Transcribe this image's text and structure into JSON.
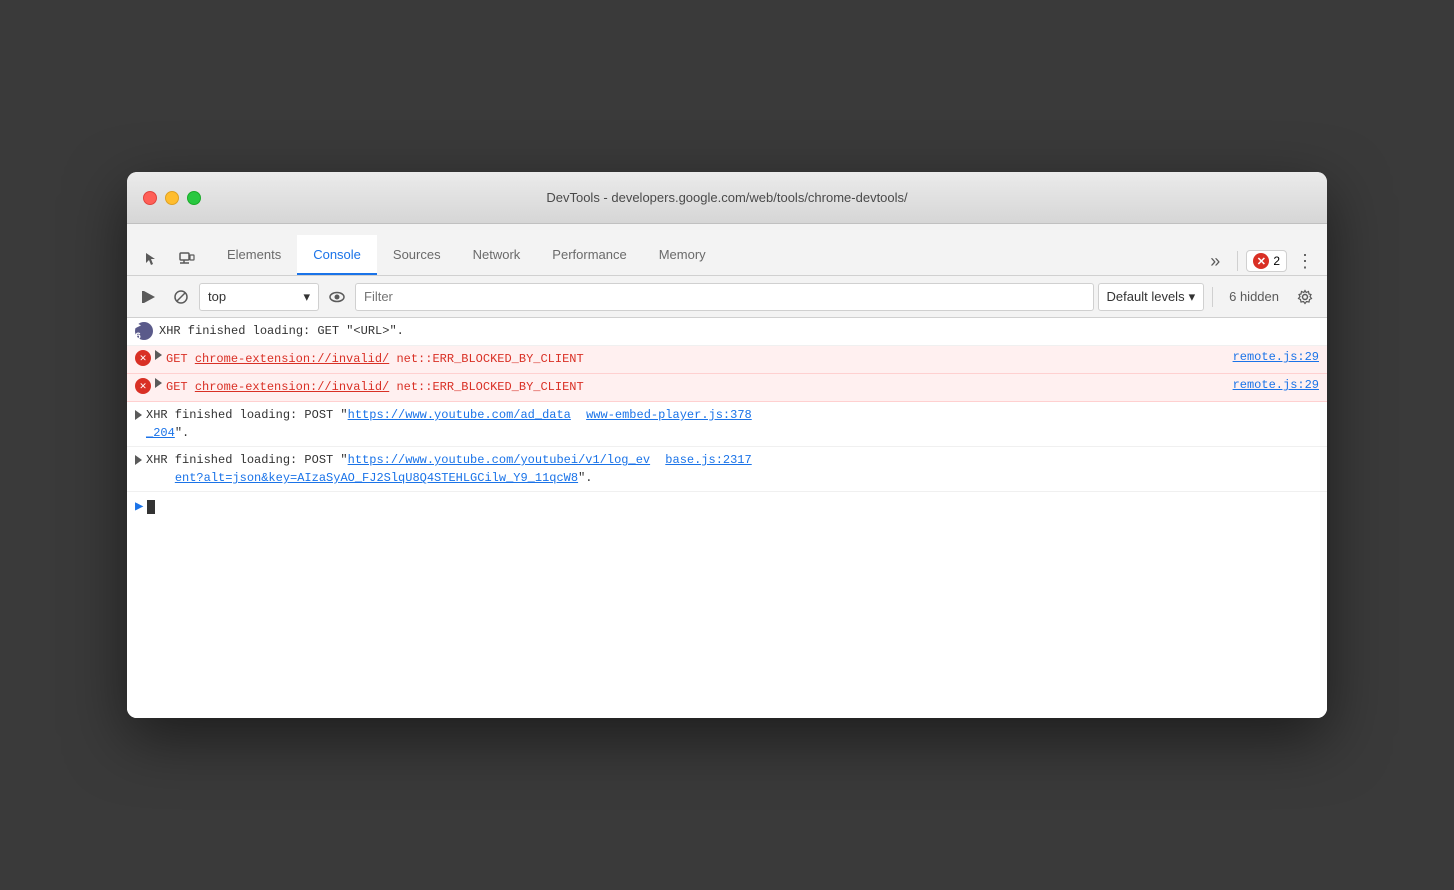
{
  "window": {
    "title": "DevTools - developers.google.com/web/tools/chrome-devtools/"
  },
  "tabs": {
    "items": [
      {
        "id": "elements",
        "label": "Elements",
        "active": false
      },
      {
        "id": "console",
        "label": "Console",
        "active": true
      },
      {
        "id": "sources",
        "label": "Sources",
        "active": false
      },
      {
        "id": "network",
        "label": "Network",
        "active": false
      },
      {
        "id": "performance",
        "label": "Performance",
        "active": false
      },
      {
        "id": "memory",
        "label": "Memory",
        "active": false
      }
    ],
    "more_label": "»",
    "error_count": "2",
    "more_options": "⋮"
  },
  "toolbar": {
    "context_value": "top",
    "context_arrow": "▾",
    "filter_placeholder": "Filter",
    "levels_label": "Default levels",
    "levels_arrow": "▾",
    "hidden_count": "6 hidden"
  },
  "console_entries": [
    {
      "id": "xhr1",
      "type": "xhr",
      "badge": "▶ 6",
      "text": "XHR finished loading: GET \"<URL>\".",
      "source": null,
      "error": false
    },
    {
      "id": "err1",
      "type": "error",
      "text": "GET",
      "url": "chrome-extension://invalid/",
      "error_text": "net::ERR_BLOCKED_BY_CLIENT",
      "source": "remote.js:29",
      "error": true
    },
    {
      "id": "err2",
      "type": "error",
      "text": "GET",
      "url": "chrome-extension://invalid/",
      "error_text": "net::ERR_BLOCKED_BY_CLIENT",
      "source": "remote.js:29",
      "error": true
    },
    {
      "id": "xhr2",
      "type": "xhr-multi",
      "text": "XHR finished loading: POST \"",
      "url": "https://www.youtube.com/ad_data",
      "url_end": "\".",
      "source": "www-embed-player.js:378\n_204",
      "source_display": "www-embed-player.js:378\n_204",
      "error": false
    },
    {
      "id": "xhr3",
      "type": "xhr-multi2",
      "text": "XHR finished loading: POST \"",
      "url": "https://www.youtube.com/youtubei/v1/log_ev",
      "url_suffix": "ent?alt=json&key=AIzaSyAO_FJ2SlqU8Q4STEHLGCilw_Y9_11qcW8",
      "url_end": "\".",
      "source": "base.js:2317",
      "error": false
    }
  ]
}
